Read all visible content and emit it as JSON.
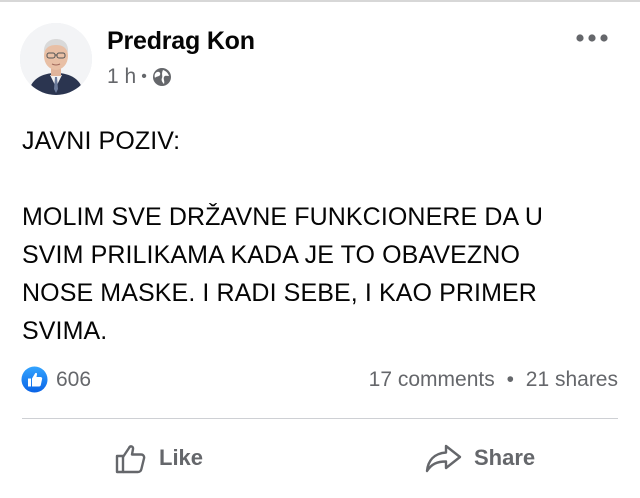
{
  "post": {
    "author": "Predrag Kon",
    "time": "1 h",
    "meta_separator": "•",
    "privacy_icon": "globe-icon",
    "text_title": "JAVNI POZIV:",
    "text_body": "MOLIM SVE DRŽAVNE FUNKCIONERE DA U\nSVIM PRILIKAMA KADA JE TO OBAVEZNO\nNOSE MASKE. I RADI SEBE, I KAO PRIMER\nSVIMA."
  },
  "stats": {
    "reactions": "606",
    "comments": "17 comments",
    "separator": "•",
    "shares": "21 shares"
  },
  "actions": {
    "like_label": "Like",
    "share_label": "Share"
  },
  "colors": {
    "text": "#050505",
    "secondary": "#65676b",
    "like_blue": "#1877f2",
    "divider": "#ced0d4"
  }
}
